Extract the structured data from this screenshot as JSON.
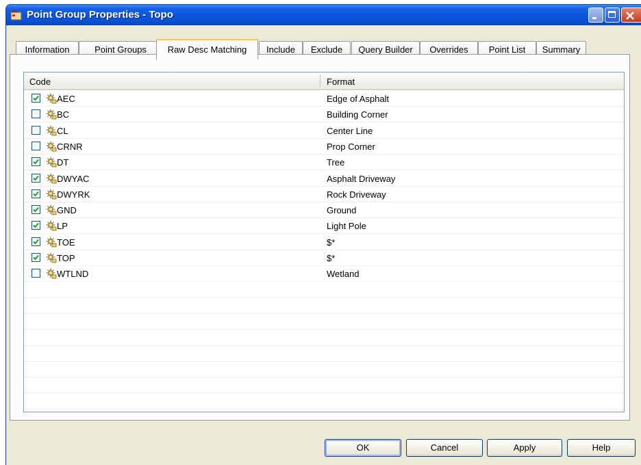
{
  "window": {
    "title": "Point Group Properties - Topo"
  },
  "tabs": [
    {
      "label": "Information"
    },
    {
      "label": "Point Groups"
    },
    {
      "label": "Raw Desc Matching",
      "active": true
    },
    {
      "label": "Include"
    },
    {
      "label": "Exclude"
    },
    {
      "label": "Query Builder"
    },
    {
      "label": "Overrides"
    },
    {
      "label": "Point List"
    },
    {
      "label": "Summary"
    }
  ],
  "list": {
    "columns": {
      "code": "Code",
      "format": "Format"
    },
    "rows": [
      {
        "checked": true,
        "code": "AEC",
        "format": "Edge of Asphalt"
      },
      {
        "checked": false,
        "code": "BC",
        "format": "Building Corner"
      },
      {
        "checked": false,
        "code": "CL",
        "format": "Center Line"
      },
      {
        "checked": false,
        "code": "CRNR",
        "format": "Prop Corner"
      },
      {
        "checked": true,
        "code": "DT",
        "format": "Tree"
      },
      {
        "checked": true,
        "code": "DWYAC",
        "format": "Asphalt Driveway"
      },
      {
        "checked": true,
        "code": "DWYRK",
        "format": "Rock Driveway"
      },
      {
        "checked": true,
        "code": "GND",
        "format": "Ground"
      },
      {
        "checked": true,
        "code": "LP",
        "format": "Light Pole"
      },
      {
        "checked": true,
        "code": "TOE",
        "format": "$*"
      },
      {
        "checked": true,
        "code": "TOP",
        "format": "$*"
      },
      {
        "checked": false,
        "code": "WTLND",
        "format": "Wetland"
      }
    ],
    "row_icon": "raw-description-icon"
  },
  "buttons": {
    "ok": "OK",
    "cancel": "Cancel",
    "apply": "Apply",
    "help": "Help"
  },
  "colors": {
    "titlebar": "#0a56dc",
    "active_tab_highlight": "#ffc83c",
    "check": "#21a121",
    "dialog_face": "#ece9d8"
  }
}
